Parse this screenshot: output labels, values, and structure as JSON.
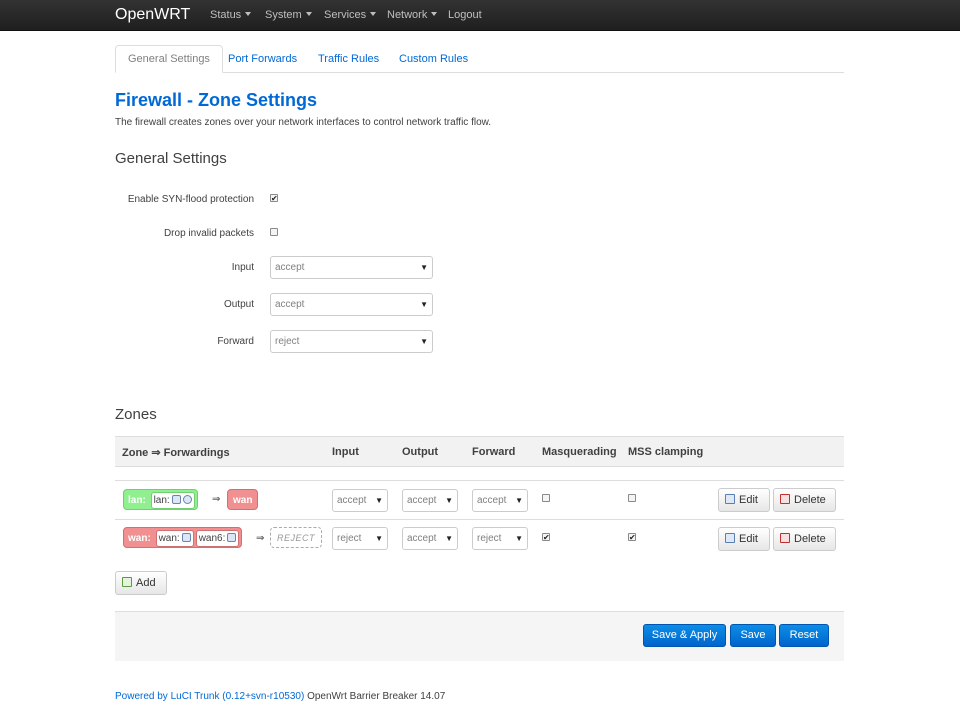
{
  "brand": "OpenWRT",
  "nav": {
    "status": "Status",
    "system": "System",
    "services": "Services",
    "network": "Network",
    "logout": "Logout"
  },
  "tabs": [
    "General Settings",
    "Port Forwards",
    "Traffic Rules",
    "Custom Rules"
  ],
  "page": {
    "title": "Firewall - Zone Settings",
    "description": "The firewall creates zones over your network interfaces to control network traffic flow."
  },
  "general": {
    "title": "General Settings",
    "syn_label": "Enable SYN-flood protection",
    "syn_checked": true,
    "drop_label": "Drop invalid packets",
    "drop_checked": false,
    "input_label": "Input",
    "input_value": "accept",
    "output_label": "Output",
    "output_value": "accept",
    "forward_label": "Forward",
    "forward_value": "reject"
  },
  "zones": {
    "title": "Zones",
    "headers": {
      "zone": "Zone ⇒ Forwardings",
      "input": "Input",
      "output": "Output",
      "forward": "Forward",
      "masq": "Masquerading",
      "mss": "MSS clamping"
    },
    "rows": [
      {
        "zone": "lan:",
        "ifaces": [
          "lan:"
        ],
        "arrow": "⇒",
        "target": "wan",
        "input": "accept",
        "output": "accept",
        "forward": "accept",
        "masq": false,
        "mss": false,
        "edit": "Edit",
        "delete": "Delete"
      },
      {
        "zone": "wan:",
        "ifaces": [
          "wan:",
          "wan6:"
        ],
        "arrow": "⇒",
        "target": "REJECT",
        "input": "reject",
        "output": "accept",
        "forward": "reject",
        "masq": true,
        "mss": true,
        "edit": "Edit",
        "delete": "Delete"
      }
    ],
    "add": "Add"
  },
  "actions": {
    "save_apply": "Save & Apply",
    "save": "Save",
    "reset": "Reset"
  },
  "footer": {
    "powered": "Powered by LuCI Trunk (0.12+svn-r10530)",
    "version": "OpenWrt Barrier Breaker 14.07"
  },
  "colors": {
    "lan_zone": "#90f090",
    "wan_zone": "#f09090",
    "link": "#0069d6",
    "primary_button": "#0064cd"
  }
}
